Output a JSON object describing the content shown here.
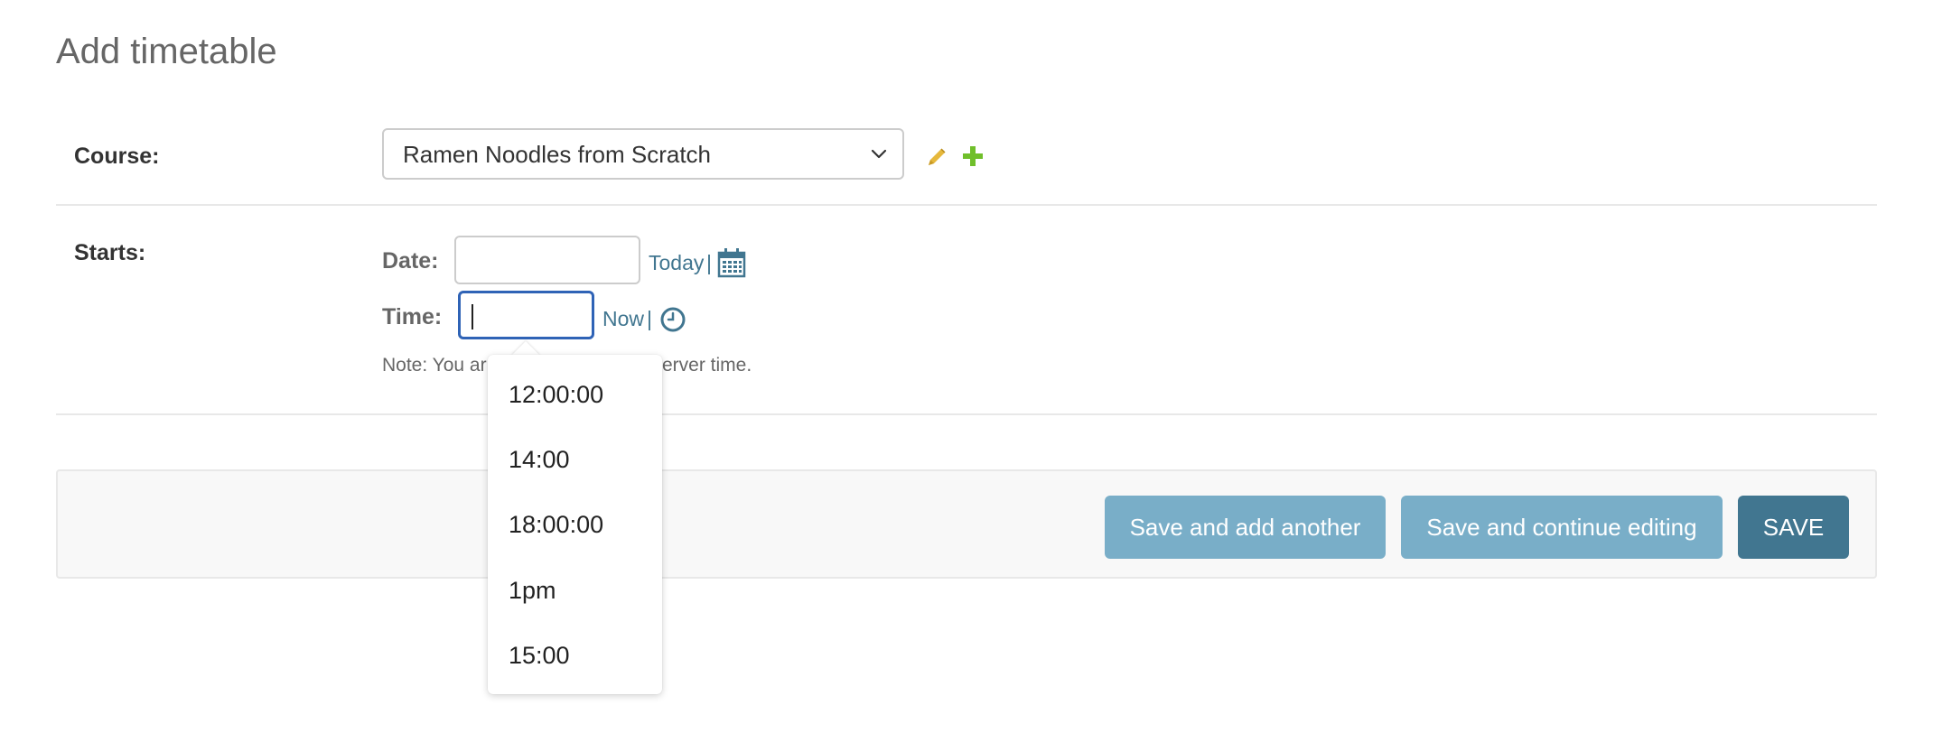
{
  "page": {
    "title": "Add timetable"
  },
  "course": {
    "label": "Course:",
    "selected": "Ramen Noodles from Scratch",
    "edit_icon": "pencil-icon",
    "add_icon": "plus-icon"
  },
  "starts": {
    "label": "Starts:",
    "date": {
      "label": "Date:",
      "value": "",
      "today_link": "Today",
      "separator": "|",
      "icon": "calendar-icon"
    },
    "time": {
      "label": "Time:",
      "value": "",
      "now_link": "Now",
      "separator": "|",
      "icon": "clock-icon"
    },
    "note": "Note: You ar",
    "note_tail": "erver time."
  },
  "time_choices": [
    "12:00:00",
    "14:00",
    "18:00:00",
    "1pm",
    "15:00"
  ],
  "buttons": {
    "save_add_another": "Save and add another",
    "save_continue": "Save and continue editing",
    "save": "SAVE"
  },
  "colors": {
    "link": "#417690",
    "primary_button": "#417690",
    "secondary_button": "#79aec8",
    "focus_border": "#2f63b6",
    "edit_icon": "#e6b83c",
    "add_icon": "#70bf2b"
  }
}
